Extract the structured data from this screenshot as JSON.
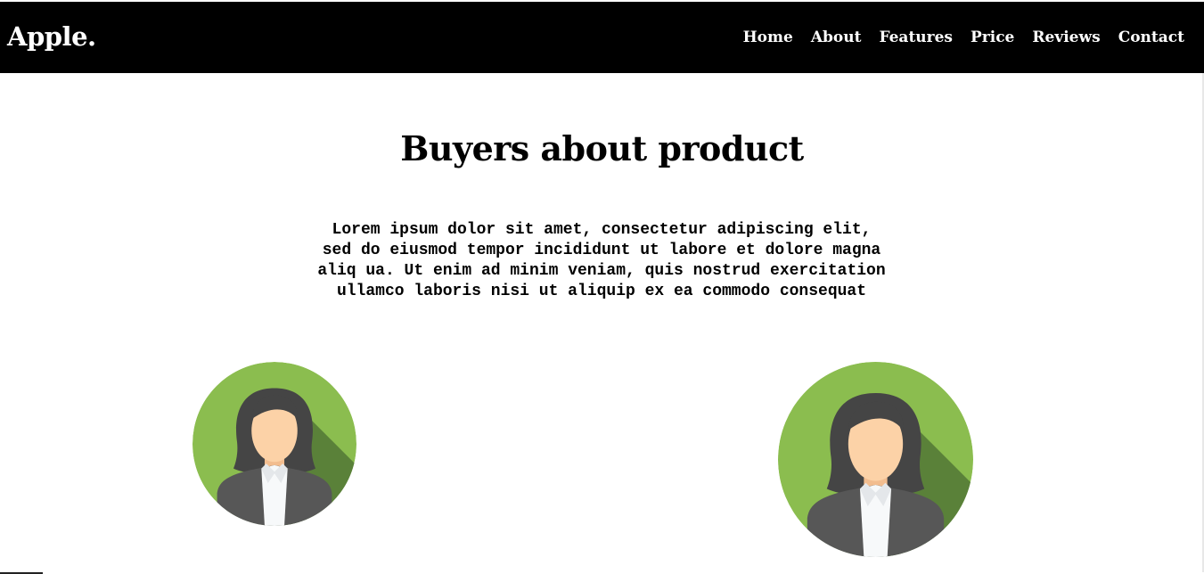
{
  "nav": {
    "brand": "Apple.",
    "links": [
      {
        "label": "Home"
      },
      {
        "label": "About"
      },
      {
        "label": "Features"
      },
      {
        "label": "Price"
      },
      {
        "label": "Reviews"
      },
      {
        "label": "Contact"
      }
    ]
  },
  "reviews": {
    "heading": "Buyers about product",
    "description_lines": [
      "Lorem ipsum dolor sit amet, consectetur adipiscing elit,",
      "sed do eiusmod tempor incididunt ut labore et dolore magna",
      "aliq ua. Ut enim ad minim veniam, quis nostrud exercitation",
      "ullamco laboris nisi ut aliquip ex ea commodo consequat"
    ],
    "avatars": [
      {
        "icon": "woman-avatar-icon"
      },
      {
        "icon": "woman-avatar-icon"
      }
    ]
  },
  "colors": {
    "navbar_bg": "#000000",
    "nav_text": "#ffffff",
    "avatar_green": "#8bbd4f",
    "avatar_shadow": "#5a8139",
    "hair": "#454545",
    "skin": "#fcd2a7",
    "jacket": "#575757",
    "shirt": "#f7f9fa"
  }
}
